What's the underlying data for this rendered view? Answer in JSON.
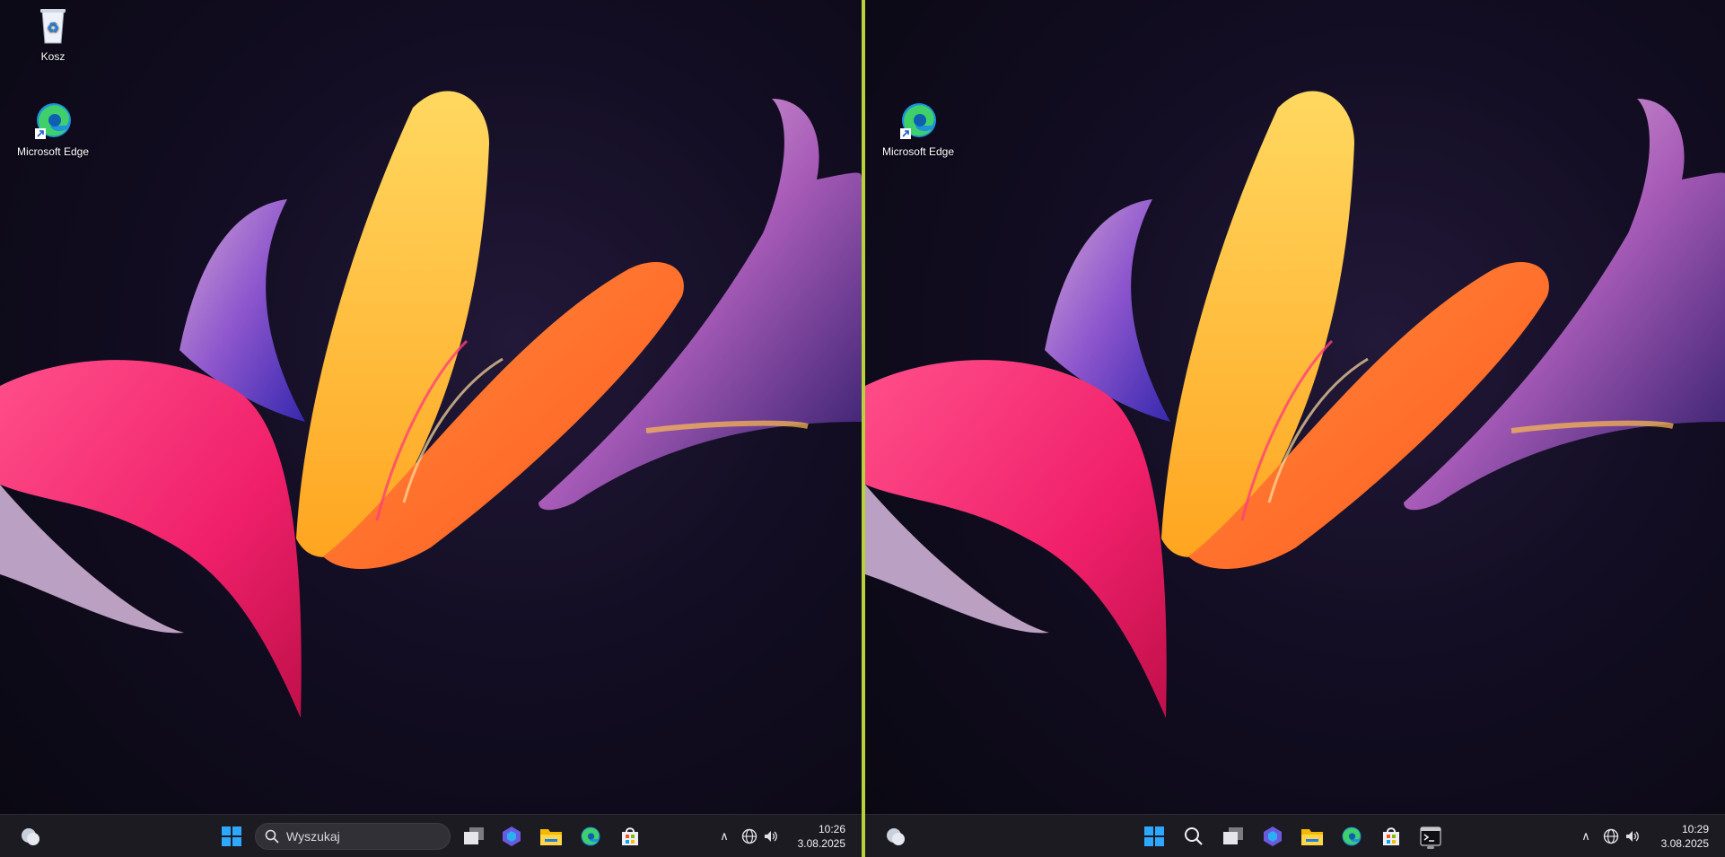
{
  "left_screen": {
    "desktop_icons": [
      {
        "label": "Kosz",
        "icon": "recycle-bin-icon"
      },
      {
        "label": "Microsoft Edge",
        "icon": "edge-icon"
      }
    ],
    "taskbar": {
      "search_placeholder": "Wyszukaj",
      "pinned": [
        "start-icon",
        "search-box",
        "task-view-icon",
        "copilot-icon",
        "file-explorer-icon",
        "edge-icon",
        "store-icon"
      ],
      "time": "10:26",
      "date": "3.08.2025"
    }
  },
  "right_screen": {
    "desktop_icons": [
      {
        "label": "Microsoft Edge",
        "icon": "edge-icon"
      }
    ],
    "taskbar": {
      "pinned": [
        "start-icon",
        "search-icon",
        "task-view-icon",
        "copilot-icon",
        "file-explorer-icon",
        "edge-icon",
        "store-icon",
        "terminal-icon"
      ],
      "time": "10:29",
      "date": "3.08.2025"
    }
  },
  "colors": {
    "divider": "#b8d23a",
    "taskbar": "#1c1b22",
    "accent_blue": "#2ea7ff"
  }
}
